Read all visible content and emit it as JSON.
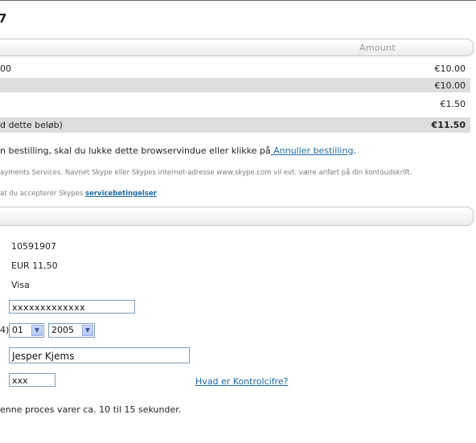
{
  "order": {
    "title": "7",
    "amount_header": "Amount",
    "rows": [
      {
        "label": "00",
        "amount": "€10.00",
        "shaded": false
      },
      {
        "label": "",
        "amount": "€10.00",
        "shaded": true
      },
      {
        "label": "",
        "amount": "€1.50",
        "shaded": false
      },
      {
        "label": "d dette beløb)",
        "amount": "€11.50",
        "shaded": true
      }
    ]
  },
  "notice": {
    "cancel_text": "n bestilling, skal du lukke dette browservindue eller klikke på",
    "cancel_link": " Annuller bestilling",
    "cancel_end": ".",
    "statement_text": "ayments Services. Navnet Skype eller Skypes internet-adresse www.skype.com vil evt. være anført på din kontoudskrift.",
    "terms_text": "at du accepterer Skypes ",
    "terms_link": "servicebetingelser "
  },
  "payment": {
    "order_number": "10591907",
    "amount": "EUR 11,50",
    "card_type": "Visa",
    "card_number": "xxxxxxxxxxxxx",
    "expiry_label_fragment": "4)",
    "expiry_month": "01",
    "expiry_year": "2005",
    "cardholder_name": "Jesper Kjems",
    "cvv": "xxx",
    "cvv_help_link": "Hvad er Kontrolcifre?",
    "process_note": "enne proces varer ca. 10 til 15 sekunder."
  },
  "colors": {
    "link": "#1c6aa6",
    "row_shade": "#dddddd",
    "input_border": "#7f9db9"
  }
}
